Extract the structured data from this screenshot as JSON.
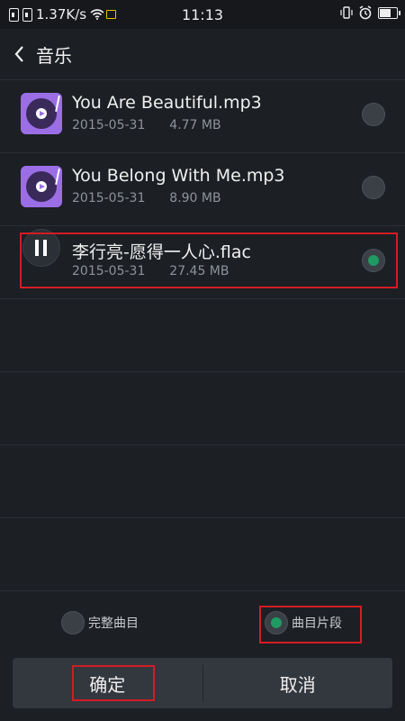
{
  "statusbar": {
    "network_speed": "1.37K/s",
    "time": "11:13"
  },
  "header": {
    "title": "音乐"
  },
  "tracks": [
    {
      "title": "You Are Beautiful.mp3",
      "date": "2015-05-31",
      "size": "4.77 MB",
      "selected": false,
      "playing": false
    },
    {
      "title": "You Belong With Me.mp3",
      "date": "2015-05-31",
      "size": "8.90 MB",
      "selected": false,
      "playing": false
    },
    {
      "title": "李行亮-愿得一人心.flac",
      "date": "2015-05-31",
      "size": "27.45 MB",
      "selected": true,
      "playing": true
    }
  ],
  "options": {
    "full_label": "完整曲目",
    "clip_label": "曲目片段",
    "selected": "clip"
  },
  "actions": {
    "confirm_label": "确定",
    "cancel_label": "取消"
  },
  "colors": {
    "accent": "#1e9a62",
    "highlight": "#d21c24",
    "thumb": "#9b6ee6",
    "background": "#1c1f24"
  },
  "icons": {
    "back": "chevron-left-icon",
    "music": "music-disc-icon",
    "pause": "pause-icon"
  }
}
